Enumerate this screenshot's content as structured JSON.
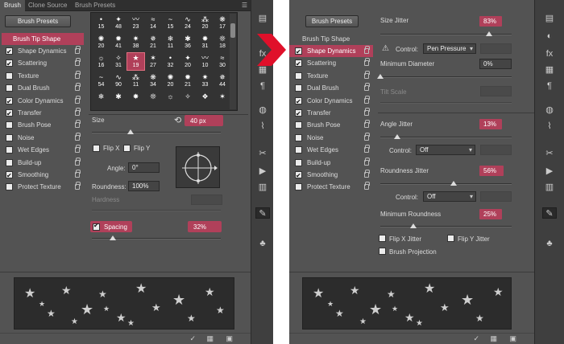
{
  "left": {
    "tabs": [
      "Brush",
      "Clone Source",
      "Brush Presets"
    ],
    "brush_presets_button": "Brush Presets",
    "brush_tip_shape": "Brush Tip Shape",
    "options": [
      {
        "label": "Shape Dynamics",
        "checked": true
      },
      {
        "label": "Scattering",
        "checked": true
      },
      {
        "label": "Texture",
        "checked": false
      },
      {
        "label": "Dual Brush",
        "checked": false
      },
      {
        "label": "Color Dynamics",
        "checked": true
      },
      {
        "label": "Transfer",
        "checked": true
      },
      {
        "label": "Brush Pose",
        "checked": false
      },
      {
        "label": "Noise",
        "checked": false
      },
      {
        "label": "Wet Edges",
        "checked": false
      },
      {
        "label": "Build-up",
        "checked": false
      },
      {
        "label": "Smoothing",
        "checked": true
      },
      {
        "label": "Protect Texture",
        "checked": false
      }
    ],
    "grid_rows": [
      [
        "15",
        "48",
        "23",
        "14",
        "15",
        "24",
        "20",
        "17"
      ],
      [
        "20",
        "41",
        "38",
        "21",
        "11",
        "36",
        "31",
        "18"
      ],
      [
        "16",
        "31",
        "19",
        "27",
        "32",
        "20",
        "10",
        "30"
      ],
      [
        "54",
        "90",
        "11",
        "34",
        "20",
        "21",
        "33",
        "44"
      ],
      [
        "",
        "",
        "",
        "",
        "",
        "",
        "",
        ""
      ]
    ],
    "selected_brush": "19",
    "size_label": "Size",
    "size_value": "40 px",
    "flip_x": "Flip X",
    "flip_y": "Flip Y",
    "angle_label": "Angle:",
    "angle_value": "0°",
    "roundness_label": "Roundness:",
    "roundness_value": "100%",
    "hardness_label": "Hardness",
    "spacing_label": "Spacing",
    "spacing_value": "32%",
    "slider_size": 0.3,
    "slider_spacing": 0.16
  },
  "right": {
    "brush_presets_button": "Brush Presets",
    "brush_tip_shape": "Brush Tip Shape",
    "options": [
      {
        "label": "Shape Dynamics",
        "checked": true,
        "selected": true
      },
      {
        "label": "Scattering",
        "checked": true
      },
      {
        "label": "Texture",
        "checked": false
      },
      {
        "label": "Dual Brush",
        "checked": false
      },
      {
        "label": "Color Dynamics",
        "checked": true
      },
      {
        "label": "Transfer",
        "checked": true
      },
      {
        "label": "Brush Pose",
        "checked": false
      },
      {
        "label": "Noise",
        "checked": false
      },
      {
        "label": "Wet Edges",
        "checked": false
      },
      {
        "label": "Build-up",
        "checked": false
      },
      {
        "label": "Smoothing",
        "checked": true
      },
      {
        "label": "Protect Texture",
        "checked": false
      }
    ],
    "size_jitter_label": "Size Jitter",
    "size_jitter_value": "83%",
    "control_label": "Control:",
    "control_value": "Pen Pressure",
    "min_diameter_label": "Minimum Diameter",
    "min_diameter_value": "0%",
    "tilt_scale_label": "Tilt Scale",
    "angle_jitter_label": "Angle Jitter",
    "angle_jitter_value": "13%",
    "control2_label": "Control:",
    "control2_value": "Off",
    "roundness_jitter_label": "Roundness Jitter",
    "roundness_jitter_value": "56%",
    "control3_label": "Control:",
    "control3_value": "Off",
    "min_roundness_label": "Minimum Roundness",
    "min_roundness_value": "25%",
    "flip_x_jitter": "Flip X Jitter",
    "flip_y_jitter": "Flip Y Jitter",
    "brush_projection": "Brush Projection",
    "slider_size_jitter": 0.83,
    "slider_angle_jitter": 0.13,
    "slider_roundness_jitter": 0.56,
    "slider_min_roundness": 0.25
  },
  "toolbar_icons": [
    "history-icon",
    "color-icon",
    "fx-icon",
    "swatches-icon",
    "paragraph-icon",
    "channels-icon",
    "paths-icon",
    "tools-icon",
    "play-icon",
    "layers-icon",
    "brush-icon",
    "clone-icon"
  ],
  "accent": "#b0405a",
  "arrow_color": "#e0102a"
}
